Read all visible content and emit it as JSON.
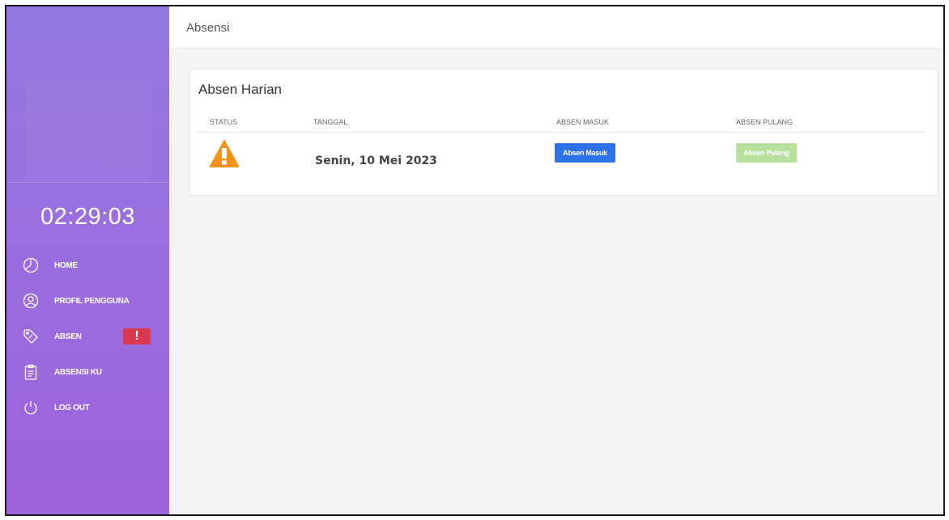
{
  "sidebar": {
    "clock": "02:29:03",
    "items": [
      {
        "label": "HOME",
        "icon": "dashboard-icon"
      },
      {
        "label": "PROFIL PENGGUNA",
        "icon": "user-icon"
      },
      {
        "label": "ABSEN",
        "icon": "tag-icon",
        "badge": "!"
      },
      {
        "label": "ABSENSI KU",
        "icon": "clipboard-icon"
      },
      {
        "label": "LOG OUT",
        "icon": "power-icon"
      }
    ]
  },
  "header": {
    "title": "Absensi"
  },
  "card": {
    "title": "Absen Harian",
    "columns": [
      "STATUS",
      "TANGGAL",
      "ABSEN MASUK",
      "ABSEN PULANG"
    ],
    "row": {
      "status_icon": "warning-icon",
      "date": "Senin, 10 Mei 2023",
      "masuk_button": "Absen Masuk",
      "pulang_button": "Absen Pulang"
    }
  },
  "colors": {
    "sidebar": "#9a6fdf",
    "primary": "#2d72e8",
    "success_disabled": "#b6e09c",
    "warning": "#f39418",
    "danger": "#d9394f"
  }
}
